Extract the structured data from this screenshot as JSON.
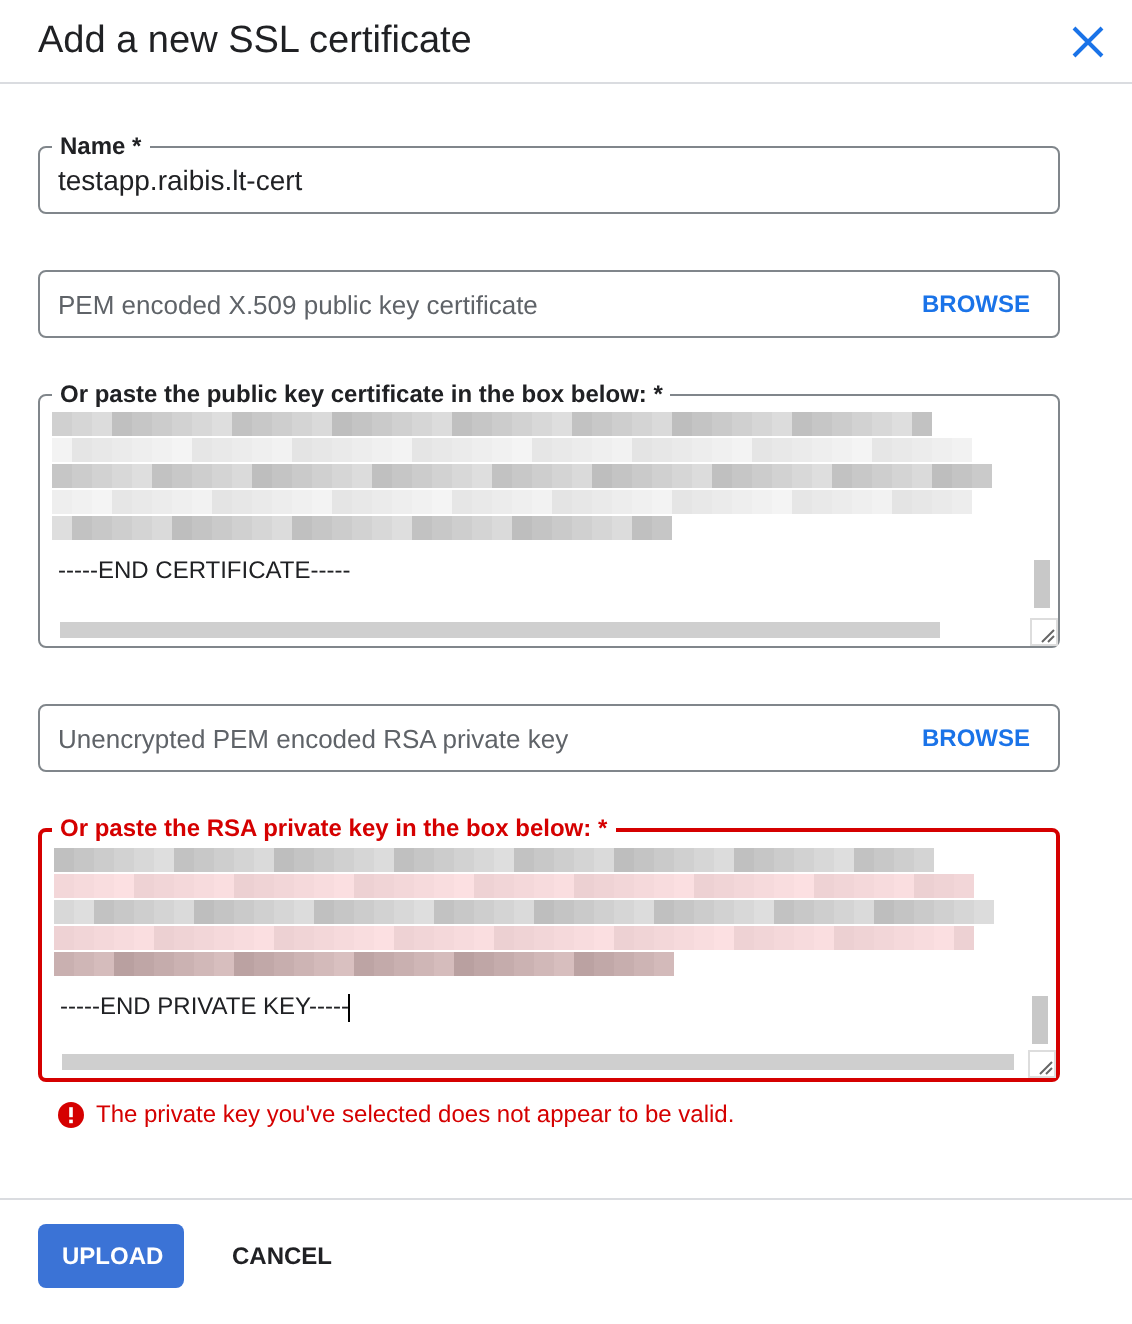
{
  "dialog": {
    "title": "Add a new SSL certificate"
  },
  "fields": [
    {
      "kind": "text",
      "label": "Name *",
      "value": "testapp.raibis.lt-cert"
    },
    {
      "kind": "file",
      "placeholder": "PEM encoded X.509 public key certificate",
      "button": "BROWSE"
    },
    {
      "kind": "textarea",
      "label": "Or paste the public key certificate in the box below: *",
      "value": "-----END CERTIFICATE-----",
      "error": false
    },
    {
      "kind": "file",
      "placeholder": "Unencrypted PEM encoded RSA private key",
      "button": "BROWSE"
    },
    {
      "kind": "textarea",
      "label": "Or paste the RSA private key in the box below: *",
      "value": "-----END PRIVATE KEY-----",
      "error": true,
      "error_message": "The private key you've selected does not appear to be valid."
    }
  ],
  "buttons": [
    {
      "label": "UPLOAD",
      "kind": "primary"
    },
    {
      "label": "CANCEL",
      "kind": "text"
    }
  ]
}
